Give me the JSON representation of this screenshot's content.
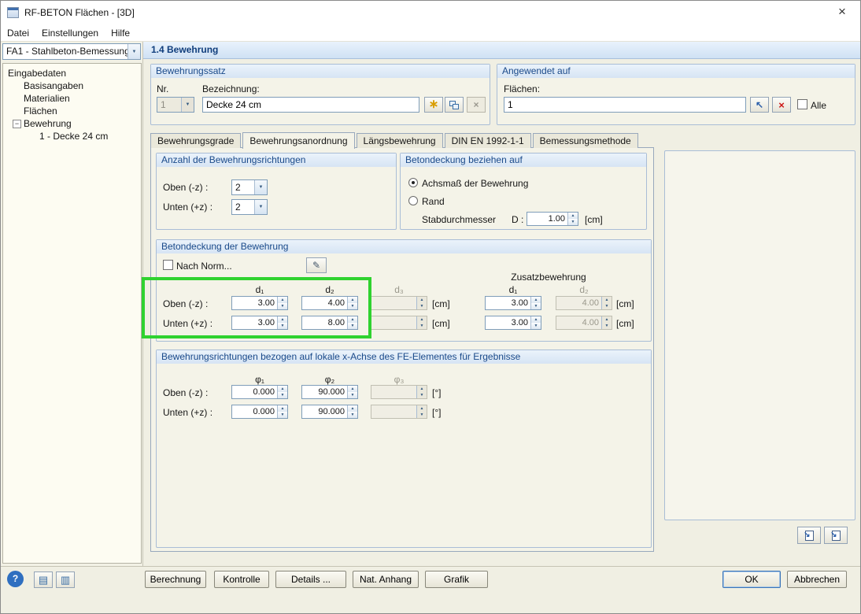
{
  "window": {
    "title": "RF-BETON Flächen - [3D]"
  },
  "icons": {
    "close": "×",
    "new": "∗",
    "delete": "×",
    "pick": "↖",
    "remove": "×",
    "norm_edit": "✎",
    "help": "?",
    "dock_left": "▤",
    "dock_right": "▥",
    "transfer": "↘",
    "tree_collapse": "−"
  },
  "menu": {
    "items": [
      "Datei",
      "Einstellungen",
      "Hilfe"
    ]
  },
  "sidebar": {
    "case": "FA1 - Stahlbeton-Bemessung",
    "tree": {
      "root": "Eingabedaten",
      "items": [
        "Basisangaben",
        "Materialien",
        "Flächen",
        "Bewehrung"
      ],
      "child": "1 - Decke 24 cm"
    }
  },
  "header": {
    "title": "1.4 Bewehrung"
  },
  "bewehrungssatz": {
    "title": "Bewehrungssatz",
    "nr_label": "Nr.",
    "nr_value": "1",
    "bezeichnung_label": "Bezeichnung:",
    "bezeichnung_value": "Decke 24 cm"
  },
  "angewendet": {
    "title": "Angewendet auf",
    "flaechen_label": "Flächen:",
    "flaechen_value": "1",
    "alle_label": "Alle"
  },
  "tabs": {
    "items": [
      "Bewehrungsgrade",
      "Bewehrungsanordnung",
      "Längsbewehrung",
      "DIN EN 1992-1-1",
      "Bemessungsmethode"
    ],
    "active": "Bewehrungsanordnung"
  },
  "anzahl": {
    "title": "Anzahl der Bewehrungsrichtungen",
    "rows": [
      {
        "label": "Oben (-z) :",
        "value": "2"
      },
      {
        "label": "Unten (+z) :",
        "value": "2"
      }
    ]
  },
  "bezug": {
    "title": "Betondeckung beziehen auf",
    "option1": "Achsmaß der Bewehrung",
    "option2": "Rand",
    "stab_label": "Stabdurchmesser",
    "d_label": "D :",
    "d_value": "1.00",
    "unit": "[cm]"
  },
  "deckung": {
    "title": "Betondeckung der Bewehrung",
    "nach_norm_label": "Nach Norm...",
    "headers": {
      "d1": "d₁",
      "d2": "d₂",
      "d3": "d₃"
    },
    "zusatz_title": "Zusatzbewehrung",
    "zusatz_headers": {
      "d1": "d₁",
      "d2": "d₂"
    },
    "unit": "[cm]",
    "rows": [
      {
        "label": "Oben (-z) :",
        "d1": "3.00",
        "d2": "4.00",
        "d3": "",
        "z1": "3.00",
        "z2": "4.00"
      },
      {
        "label": "Unten (+z) :",
        "d1": "3.00",
        "d2": "8.00",
        "d3": "",
        "z1": "3.00",
        "z2": "4.00"
      }
    ]
  },
  "richtungen": {
    "title": "Bewehrungsrichtungen bezogen auf lokale x-Achse des FE-Elementes für Ergebnisse",
    "headers": {
      "p1": "φ₁",
      "p2": "φ₂",
      "p3": "φ₃"
    },
    "unit": "[°]",
    "rows": [
      {
        "label": "Oben (-z) :",
        "v1": "0.000",
        "v2": "90.000",
        "v3": ""
      },
      {
        "label": "Unten (+z) :",
        "v1": "0.000",
        "v2": "90.000",
        "v3": ""
      }
    ]
  },
  "footer": {
    "buttons": [
      "Berechnung",
      "Kontrolle",
      "Details ...",
      "Nat. Anhang",
      "Grafik"
    ],
    "ok": "OK",
    "cancel": "Abbrechen"
  }
}
